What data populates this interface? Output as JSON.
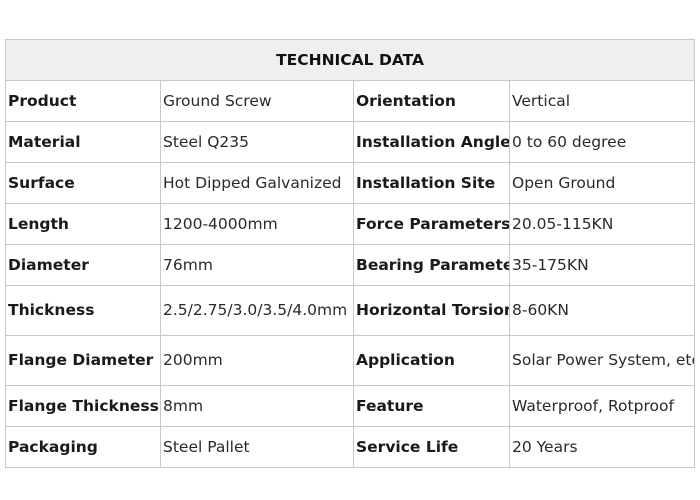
{
  "table": {
    "title": "TECHNICAL DATA",
    "rows": [
      [
        "Product",
        "Ground Screw",
        "Orientation",
        "Vertical"
      ],
      [
        "Material",
        "Steel Q235",
        "Installation Angle",
        "0 to 60 degree"
      ],
      [
        "Surface",
        "Hot Dipped Galvanized",
        "Installation Site",
        "Open Ground"
      ],
      [
        "Length",
        "1200-4000mm",
        "Force Parameters",
        "20.05-115KN"
      ],
      [
        "Diameter",
        "76mm",
        "Bearing Parameters",
        "35-175KN"
      ],
      [
        "Thickness",
        "2.5/2.75/3.0/3.5/4.0mm",
        "Horizontal Torsion",
        "8-60KN"
      ],
      [
        "Flange Diameter",
        "200mm",
        "Application",
        "Solar Power System, etc"
      ],
      [
        "Flange Thickness",
        "8mm",
        "Feature",
        "Waterproof, Rotproof"
      ],
      [
        "Packaging",
        "Steel Pallet",
        "Service Life",
        "20 Years"
      ]
    ]
  }
}
